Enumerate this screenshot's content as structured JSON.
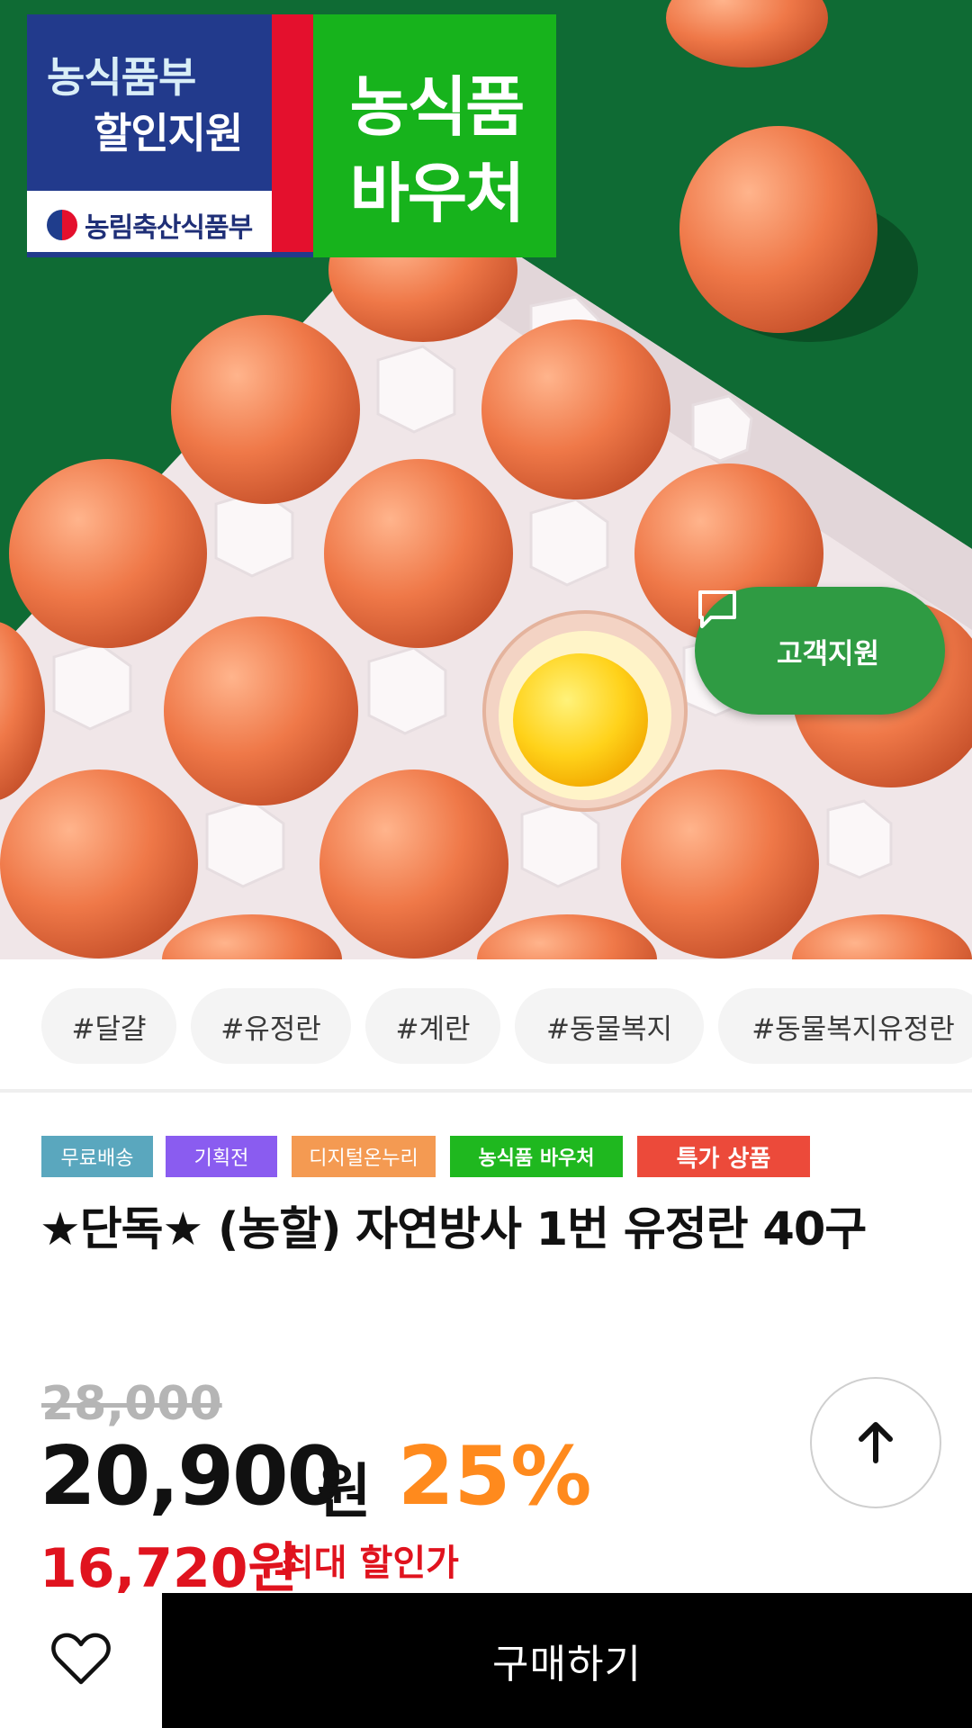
{
  "hero": {
    "badge_left": {
      "line1": "농식품부",
      "line2": "할인지원",
      "ministry": "농림축산식품부"
    },
    "badge_right": {
      "line1": "농식품",
      "line2": "바우처"
    }
  },
  "support_button": {
    "label": "고객지원",
    "icon": "chat-bubble-icon"
  },
  "tags": [
    "#달걀",
    "#유정란",
    "#계란",
    "#동물복지",
    "#동물복지유정란"
  ],
  "labels": [
    {
      "text": "무료배송",
      "color": "#5aa7be"
    },
    {
      "text": "기획전",
      "color": "#8a5cf0"
    },
    {
      "text": "디지털온누리",
      "color": "#f49a52"
    },
    {
      "text": "농식품 바우처",
      "color": "#1fb81f"
    },
    {
      "text": "특가 상품",
      "color": "#ec4a3a"
    }
  ],
  "product": {
    "title": "★단독★ (농할) 자연방사 1번 유정란 40구",
    "original_price": "28,000",
    "price": "20,900",
    "price_unit": "원",
    "discount": "25%",
    "max_discount_price": "16,720원",
    "max_discount_label": "최대 할인가"
  },
  "scroll_top": {
    "icon": "arrow-up-icon"
  },
  "bottom_bar": {
    "wishlist_icon": "heart-icon",
    "buy_label": "구매하기"
  },
  "colors": {
    "support_green": "#2f9b43",
    "discount_orange": "#ff8a1d",
    "sale_red": "#e0131e"
  }
}
